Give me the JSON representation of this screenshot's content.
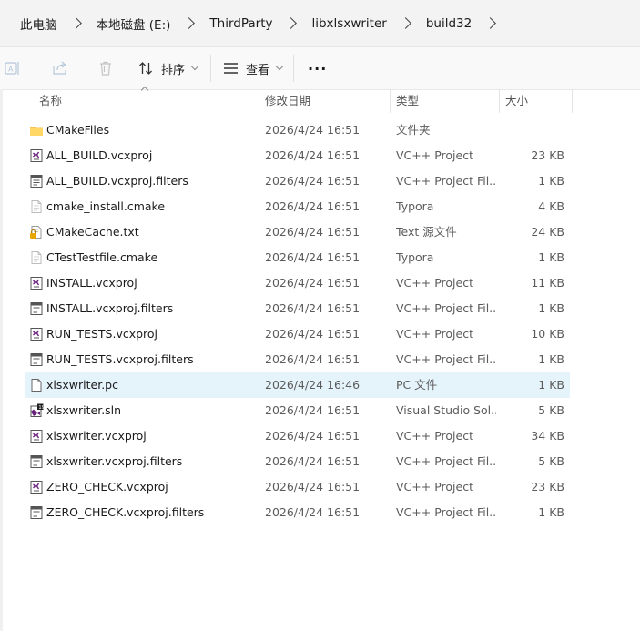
{
  "breadcrumb": [
    "此电脑",
    "本地磁盘 (E:)",
    "ThirdParty",
    "libxlsxwriter",
    "build32"
  ],
  "toolbar": {
    "sort_label": "排序",
    "view_label": "查看",
    "more_label": "···"
  },
  "columns": {
    "name": "名称",
    "date": "修改日期",
    "type": "类型",
    "size": "大小"
  },
  "files": [
    {
      "name": "CMakeFiles",
      "date": "2026/4/24 16:51",
      "type": "文件夹",
      "size": "",
      "icon": "folder-icon"
    },
    {
      "name": "ALL_BUILD.vcxproj",
      "date": "2026/4/24 16:51",
      "type": "VC++ Project",
      "size": "23 KB",
      "icon": "vcxproj-icon"
    },
    {
      "name": "ALL_BUILD.vcxproj.filters",
      "date": "2026/4/24 16:51",
      "type": "VC++ Project Fil...",
      "size": "1 KB",
      "icon": "filters-icon"
    },
    {
      "name": "cmake_install.cmake",
      "date": "2026/4/24 16:51",
      "type": "Typora",
      "size": "4 KB",
      "icon": "generic-file-icon"
    },
    {
      "name": "CMakeCache.txt",
      "date": "2026/4/24 16:51",
      "type": "Text 源文件",
      "size": "24 KB",
      "icon": "txt-lock-icon"
    },
    {
      "name": "CTestTestfile.cmake",
      "date": "2026/4/24 16:51",
      "type": "Typora",
      "size": "1 KB",
      "icon": "generic-file-icon"
    },
    {
      "name": "INSTALL.vcxproj",
      "date": "2026/4/24 16:51",
      "type": "VC++ Project",
      "size": "11 KB",
      "icon": "vcxproj-icon"
    },
    {
      "name": "INSTALL.vcxproj.filters",
      "date": "2026/4/24 16:51",
      "type": "VC++ Project Fil...",
      "size": "1 KB",
      "icon": "filters-icon"
    },
    {
      "name": "RUN_TESTS.vcxproj",
      "date": "2026/4/24 16:51",
      "type": "VC++ Project",
      "size": "10 KB",
      "icon": "vcxproj-icon"
    },
    {
      "name": "RUN_TESTS.vcxproj.filters",
      "date": "2026/4/24 16:51",
      "type": "VC++ Project Fil...",
      "size": "1 KB",
      "icon": "filters-icon"
    },
    {
      "name": "xlsxwriter.pc",
      "date": "2026/4/24 16:46",
      "type": "PC 文件",
      "size": "1 KB",
      "icon": "blank-file-icon",
      "selected": true
    },
    {
      "name": "xlsxwriter.sln",
      "date": "2026/4/24 16:51",
      "type": "Visual Studio Sol...",
      "size": "5 KB",
      "icon": "sln-icon"
    },
    {
      "name": "xlsxwriter.vcxproj",
      "date": "2026/4/24 16:51",
      "type": "VC++ Project",
      "size": "34 KB",
      "icon": "vcxproj-icon"
    },
    {
      "name": "xlsxwriter.vcxproj.filters",
      "date": "2026/4/24 16:51",
      "type": "VC++ Project Fil...",
      "size": "5 KB",
      "icon": "filters-icon"
    },
    {
      "name": "ZERO_CHECK.vcxproj",
      "date": "2026/4/24 16:51",
      "type": "VC++ Project",
      "size": "23 KB",
      "icon": "vcxproj-icon"
    },
    {
      "name": "ZERO_CHECK.vcxproj.filters",
      "date": "2026/4/24 16:51",
      "type": "VC++ Project Fil...",
      "size": "1 KB",
      "icon": "filters-icon"
    }
  ],
  "colors": {
    "selected_row": "#e5f3fb",
    "folder": "#f5c451",
    "vs_purple": "#68217a"
  }
}
